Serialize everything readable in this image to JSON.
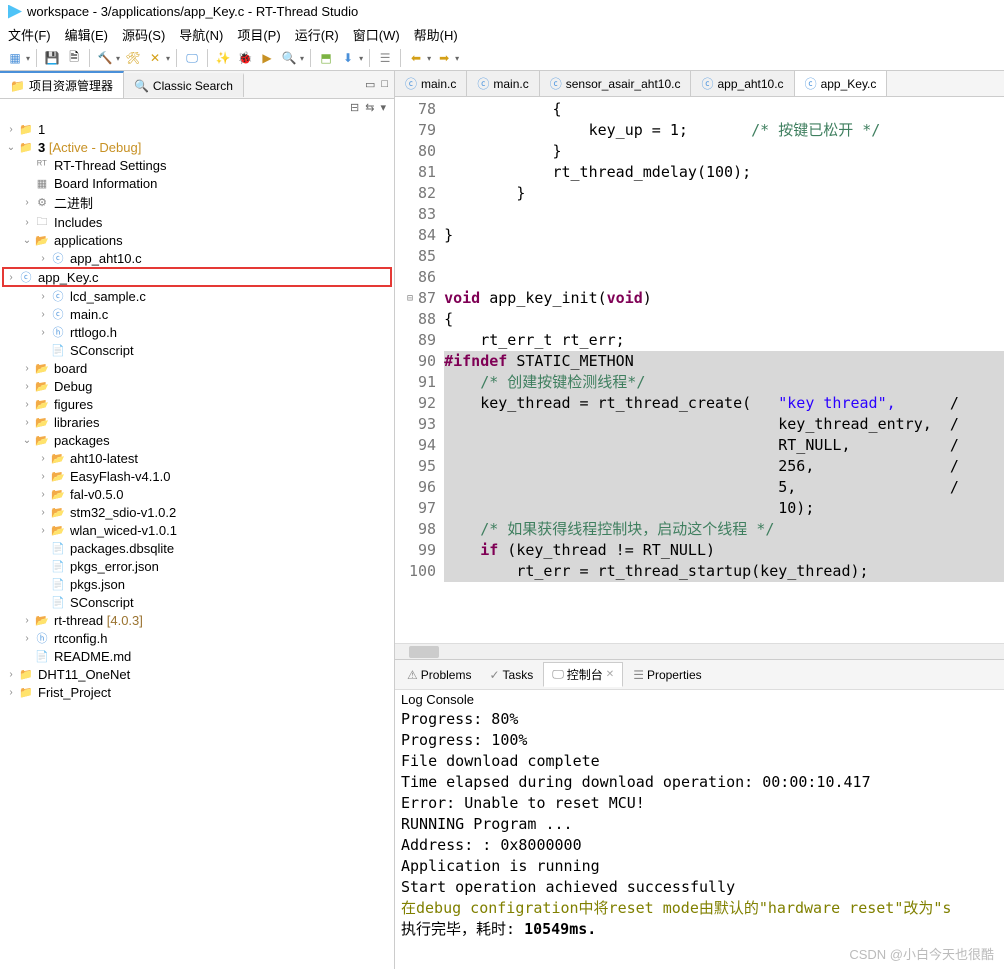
{
  "window": {
    "title": "workspace - 3/applications/app_Key.c - RT-Thread Studio"
  },
  "menu": [
    "文件(F)",
    "编辑(E)",
    "源码(S)",
    "导航(N)",
    "项目(P)",
    "运行(R)",
    "窗口(W)",
    "帮助(H)"
  ],
  "left": {
    "tab1": "项目资源管理器",
    "tab2": "Classic Search",
    "tree": [
      {
        "d": 0,
        "tw": ">",
        "ik": "proj",
        "label": "1"
      },
      {
        "d": 0,
        "tw": "v",
        "ik": "proj",
        "label": "3",
        "suffix": "[Active - Debug]",
        "suffixClass": "active-debug",
        "bold": true
      },
      {
        "d": 1,
        "tw": "",
        "ik": "rt",
        "label": "RT-Thread Settings"
      },
      {
        "d": 1,
        "tw": "",
        "ik": "board",
        "label": "Board Information"
      },
      {
        "d": 1,
        "tw": ">",
        "ik": "bin",
        "label": "二进制"
      },
      {
        "d": 1,
        "tw": ">",
        "ik": "inc",
        "label": "Includes"
      },
      {
        "d": 1,
        "tw": "v",
        "ik": "folder",
        "label": "applications"
      },
      {
        "d": 2,
        "tw": ">",
        "ik": "c",
        "label": "app_aht10.c"
      },
      {
        "d": 2,
        "tw": ">",
        "ik": "c",
        "label": "app_Key.c",
        "hl": true
      },
      {
        "d": 2,
        "tw": ">",
        "ik": "c",
        "label": "lcd_sample.c"
      },
      {
        "d": 2,
        "tw": ">",
        "ik": "c",
        "label": "main.c"
      },
      {
        "d": 2,
        "tw": ">",
        "ik": "h",
        "label": "rttlogo.h"
      },
      {
        "d": 2,
        "tw": "",
        "ik": "file",
        "label": "SConscript"
      },
      {
        "d": 1,
        "tw": ">",
        "ik": "folder",
        "label": "board"
      },
      {
        "d": 1,
        "tw": ">",
        "ik": "folder",
        "label": "Debug"
      },
      {
        "d": 1,
        "tw": ">",
        "ik": "folder",
        "label": "figures"
      },
      {
        "d": 1,
        "tw": ">",
        "ik": "folder",
        "label": "libraries"
      },
      {
        "d": 1,
        "tw": "v",
        "ik": "folder",
        "label": "packages"
      },
      {
        "d": 2,
        "tw": ">",
        "ik": "folder",
        "label": "aht10-latest"
      },
      {
        "d": 2,
        "tw": ">",
        "ik": "folder",
        "label": "EasyFlash-v4.1.0"
      },
      {
        "d": 2,
        "tw": ">",
        "ik": "folder",
        "label": "fal-v0.5.0"
      },
      {
        "d": 2,
        "tw": ">",
        "ik": "folder",
        "label": "stm32_sdio-v1.0.2"
      },
      {
        "d": 2,
        "tw": ">",
        "ik": "folder",
        "label": "wlan_wiced-v1.0.1"
      },
      {
        "d": 2,
        "tw": "",
        "ik": "file",
        "label": "packages.dbsqlite"
      },
      {
        "d": 2,
        "tw": "",
        "ik": "file",
        "label": "pkgs_error.json"
      },
      {
        "d": 2,
        "tw": "",
        "ik": "file",
        "label": "pkgs.json"
      },
      {
        "d": 2,
        "tw": "",
        "ik": "file",
        "label": "SConscript"
      },
      {
        "d": 1,
        "tw": ">",
        "ik": "folder",
        "label": "rt-thread",
        "suffix": "[4.0.3]",
        "suffixClass": "version-label"
      },
      {
        "d": 1,
        "tw": ">",
        "ik": "h",
        "label": "rtconfig.h"
      },
      {
        "d": 1,
        "tw": "",
        "ik": "md",
        "label": "README.md"
      },
      {
        "d": 0,
        "tw": ">",
        "ik": "proj",
        "label": "DHT11_OneNet"
      },
      {
        "d": 0,
        "tw": ">",
        "ik": "proj",
        "label": "Frist_Project"
      }
    ]
  },
  "editor": {
    "tabs": [
      "main.c",
      "main.c",
      "sensor_asair_aht10.c",
      "app_aht10.c",
      "app_Key.c"
    ],
    "activeTab": 4,
    "startLine": 78,
    "lines": [
      {
        "n": 78,
        "t": "            {",
        "cls": ""
      },
      {
        "n": 79,
        "t": "                key_up = 1;       /* 按键已松开 */",
        "cmt": [
          34,
          48
        ]
      },
      {
        "n": 80,
        "t": "            }",
        "cls": ""
      },
      {
        "n": 81,
        "t": "            rt_thread_mdelay(100);",
        "cls": ""
      },
      {
        "n": 82,
        "t": "        }",
        "cls": ""
      },
      {
        "n": 83,
        "t": "",
        "cls": ""
      },
      {
        "n": 84,
        "t": "}",
        "cls": ""
      },
      {
        "n": 85,
        "t": "",
        "cls": ""
      },
      {
        "n": 86,
        "t": "",
        "cls": ""
      },
      {
        "n": 87,
        "t": "void app_key_init(void)",
        "kw": [
          [
            0,
            4
          ],
          [
            18,
            22
          ]
        ],
        "bold": [
          5,
          17
        ],
        "fold": true
      },
      {
        "n": 88,
        "t": "{",
        "cls": ""
      },
      {
        "n": 89,
        "t": "    rt_err_t rt_err;",
        "cls": ""
      },
      {
        "n": 90,
        "t": "#ifndef STATIC_METHON",
        "hl": true,
        "pp": [
          0,
          7
        ]
      },
      {
        "n": 91,
        "t": "    /* 创建按键检测线程*/",
        "hl": true,
        "cmtFull": true
      },
      {
        "n": 92,
        "t": "    key_thread = rt_thread_create(   \"key thread\",      /",
        "hl": true,
        "str": [
          37,
          49
        ]
      },
      {
        "n": 93,
        "t": "                                     key_thread_entry,  /",
        "hl": true
      },
      {
        "n": 94,
        "t": "                                     RT_NULL,           /",
        "hl": true
      },
      {
        "n": 95,
        "t": "                                     256,               /",
        "hl": true
      },
      {
        "n": 96,
        "t": "                                     5,                 /",
        "hl": true
      },
      {
        "n": 97,
        "t": "                                     10);",
        "hl": true
      },
      {
        "n": 98,
        "t": "    /* 如果获得线程控制块，启动这个线程 */",
        "hl": true,
        "cmtFull": true
      },
      {
        "n": 99,
        "t": "    if (key_thread != RT_NULL)",
        "hl": true,
        "kw": [
          [
            4,
            6
          ]
        ]
      },
      {
        "n": 100,
        "t": "        rt_err = rt_thread_startup(key_thread);",
        "hl": true
      }
    ]
  },
  "bottom": {
    "tabs": [
      "Problems",
      "Tasks",
      "控制台",
      "Properties"
    ],
    "activeTab": 2,
    "title": "Log Console",
    "lines": [
      "Progress: 80%",
      "Progress: 100%",
      "File download complete",
      "Time elapsed during download operation: 00:00:10.417",
      "Error: Unable to reset MCU!",
      "RUNNING Program ...",
      "  Address:      : 0x8000000",
      "Application is running",
      "Start operation achieved successfully"
    ],
    "olive": "在debug configration中将reset mode由默认的\"hardware reset\"改为\"s",
    "final": "执行完毕，耗时: ",
    "finalBold": "10549ms."
  },
  "watermark": "CSDN @小白今天也很酷"
}
